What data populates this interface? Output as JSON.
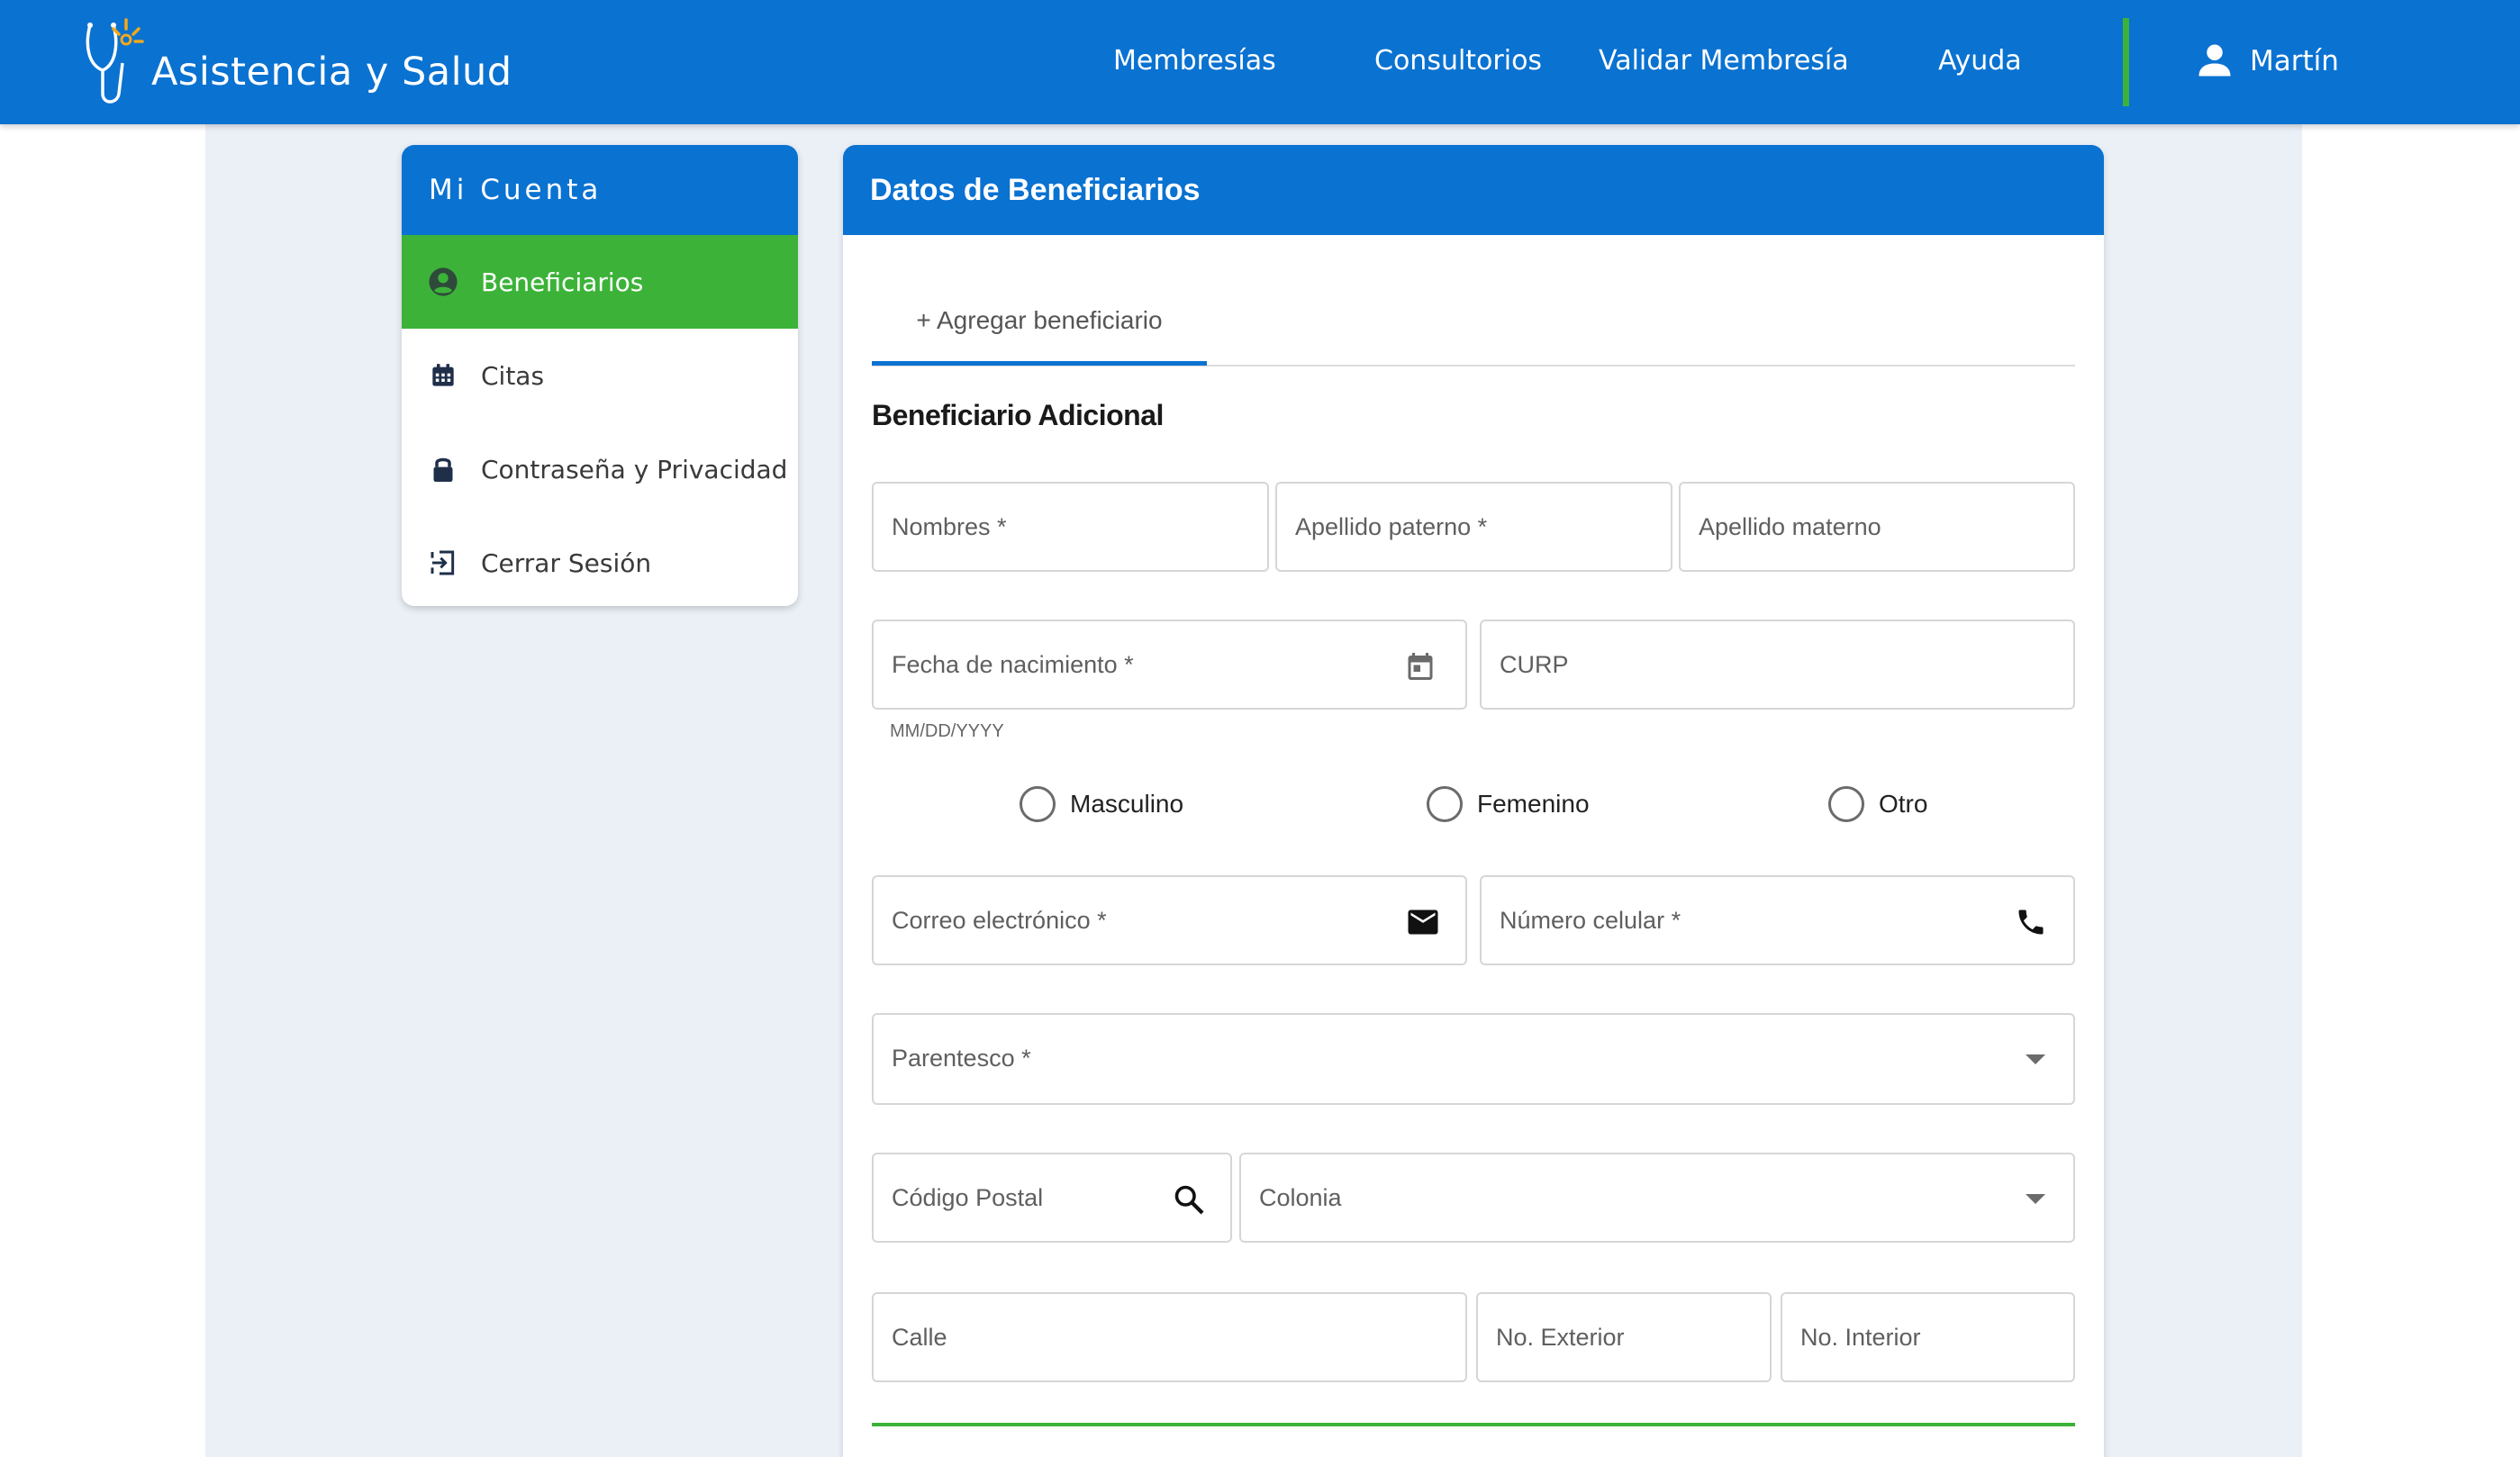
{
  "header": {
    "brand": "Asistencia y Salud",
    "nav": [
      "Membresías",
      "Consultorios",
      "Validar Membresía",
      "Ayuda"
    ],
    "user_name": "Martín"
  },
  "sidebar": {
    "title": "Mi Cuenta",
    "items": [
      {
        "label": "Beneficiarios",
        "icon": "account-circle-icon",
        "active": true
      },
      {
        "label": "Citas",
        "icon": "calendar-icon",
        "active": false
      },
      {
        "label": "Contraseña y Privacidad",
        "icon": "lock-icon",
        "active": false
      },
      {
        "label": "Cerrar Sesión",
        "icon": "logout-icon",
        "active": false
      }
    ]
  },
  "main": {
    "title": "Datos de Beneficiarios",
    "tab": "+ Agregar beneficiario",
    "section_title": "Beneficiario Adicional",
    "fields": {
      "nombres": "Nombres *",
      "apellido_paterno": "Apellido paterno *",
      "apellido_materno": "Apellido materno",
      "fecha_nacimiento": "Fecha de nacimiento *",
      "fecha_helper": "MM/DD/YYYY",
      "curp": "CURP",
      "correo": "Correo electrónico *",
      "celular": "Número celular *",
      "parentesco": "Parentesco *",
      "codigo_postal": "Código Postal",
      "colonia": "Colonia",
      "calle": "Calle",
      "no_exterior": "No. Exterior",
      "no_interior": "No. Interior"
    },
    "gender_options": [
      "Masculino",
      "Femenino",
      "Otro"
    ]
  },
  "colors": {
    "primary": "#0a72d1",
    "accent": "#3cb338",
    "background": "#ebf0f7"
  }
}
